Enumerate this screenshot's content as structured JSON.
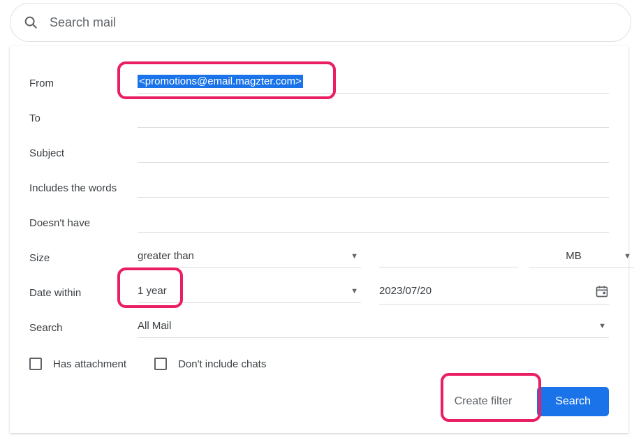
{
  "search": {
    "placeholder": "Search mail"
  },
  "labels": {
    "from": "From",
    "to": "To",
    "subject": "Subject",
    "includes": "Includes the words",
    "doesnt": "Doesn't have",
    "size": "Size",
    "date": "Date within",
    "search_in": "Search"
  },
  "values": {
    "from": "<promotions@email.magzter.com>",
    "to": "",
    "subject": "",
    "includes": "",
    "doesnt": "",
    "size_op": "greater than",
    "size_num": "",
    "size_unit": "MB",
    "date_range": "1 year",
    "date_value": "2023/07/20",
    "search_folder": "All Mail"
  },
  "checkboxes": {
    "has_attachment": "Has attachment",
    "no_chats": "Don't include chats"
  },
  "buttons": {
    "create_filter": "Create filter",
    "search": "Search"
  }
}
